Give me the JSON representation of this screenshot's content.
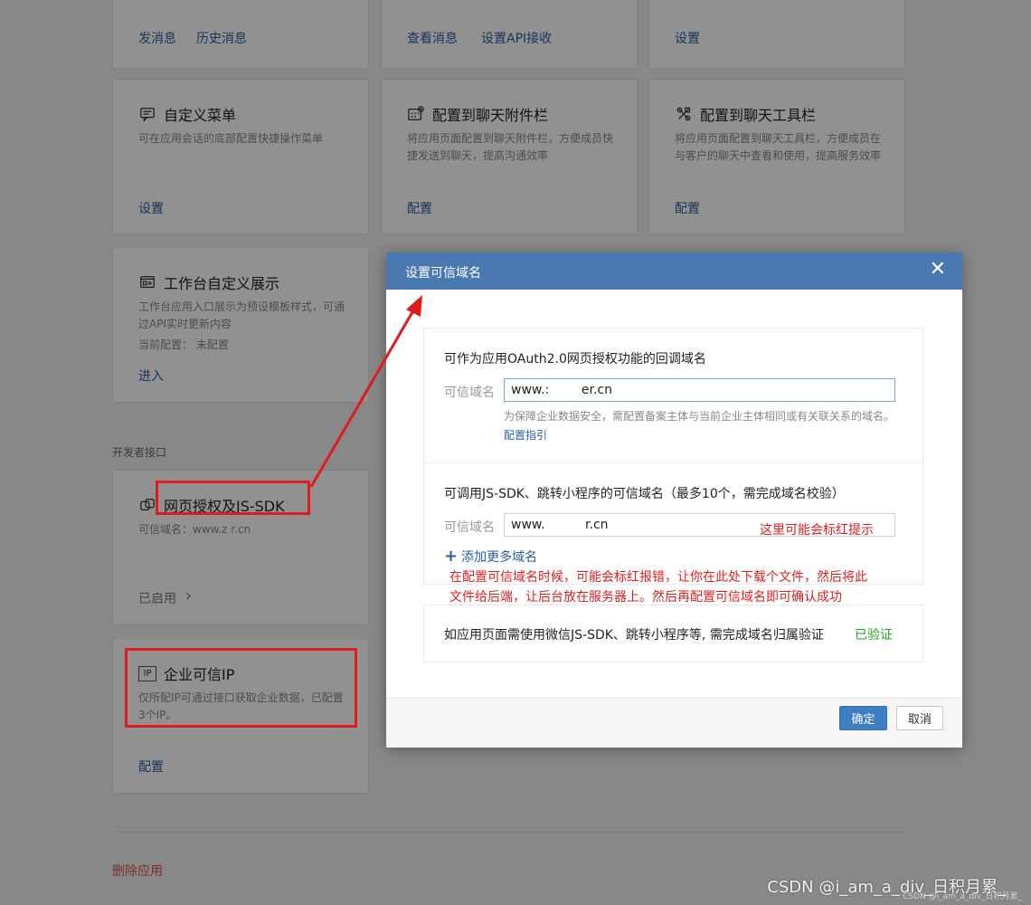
{
  "cards_top": [
    {
      "links": [
        "发消息",
        "历史消息"
      ]
    },
    {
      "links": [
        "查看消息",
        "设置API接收"
      ]
    },
    {
      "links": [
        "设置"
      ]
    }
  ],
  "cards_row2": [
    {
      "icon": "chat-menu-icon",
      "title": "自定义菜单",
      "desc": "可在应用会话的底部配置快捷操作菜单",
      "link": "设置"
    },
    {
      "icon": "attachment-grid-icon",
      "title": "配置到聊天附件栏",
      "desc": "将应用页面配置到聊天附件栏，方便成员快捷发送到聊天，提高沟通效率",
      "link": "配置"
    },
    {
      "icon": "toolbar-icon",
      "title": "配置到聊天工具栏",
      "desc": "将应用页面配置到聊天工具栏，方便成员在与客户的聊天中查看和使用，提高服务效率",
      "link": "配置"
    }
  ],
  "workbench_card": {
    "icon": "display-icon",
    "title": "工作台自定义展示",
    "desc": "工作台应用入口展示为预设模板样式，可通过API实时更新内容",
    "config": "当前配置： 未配置",
    "link": "进入"
  },
  "developer_section": "开发者接口",
  "webauth_card": {
    "icon": "link-icon",
    "title": "网页授权及JS-SDK",
    "desc": "可信域名：www.z          r.cn",
    "status": "已启用",
    "chevron": "›"
  },
  "trusted_ip_card": {
    "icon": "ip-icon",
    "icon_text": "IP",
    "title": "企业可信IP",
    "desc": "仅所配IP可通过接口获取企业数据，已配置3个IP。",
    "link": "配置"
  },
  "delete_link": "删除应用",
  "dialog": {
    "title": "设置可信域名",
    "close": "✕",
    "oauth_heading": "可作为应用OAuth2.0网页授权功能的回调域名",
    "oauth_label": "可信域名",
    "oauth_value": "www.:        er.cn",
    "oauth_hint": "为保障企业数据安全，需配置备案主体与当前企业主体相同或有关联关系的域名。",
    "oauth_hint_link": "配置指引",
    "jssdk_heading": "可调用JS-SDK、跳转小程序的可信域名（最多10个，需完成域名校验）",
    "jssdk_label": "可信域名",
    "jssdk_value": "www.          r.cn",
    "add_more": "添加更多域名",
    "add_icon": "+",
    "verify_text": "如应用页面需使用微信JS-SDK、跳转小程序等, 需完成域名归属验证",
    "verified": "已验证",
    "confirm": "确定",
    "cancel": "取消"
  },
  "annotations": {
    "red_hint": "这里可能会标红提示",
    "note_line1": "在配置可信域名时候，可能会标红报错，让你在此处下载个文件，然后将此",
    "note_line2": "文件给后端，让后台放在服务器上。然后再配置可信域名即可确认成功"
  },
  "watermark": "CSDN @i_am_a_div_日积月累_",
  "watermark_small": "CSDN @i_am_a_div_日积月累_",
  "colors": {
    "header": "#4a78b0",
    "link": "#2a5f9e",
    "annotation": "#e02020",
    "verified": "#22a822",
    "danger": "#d9534f"
  }
}
